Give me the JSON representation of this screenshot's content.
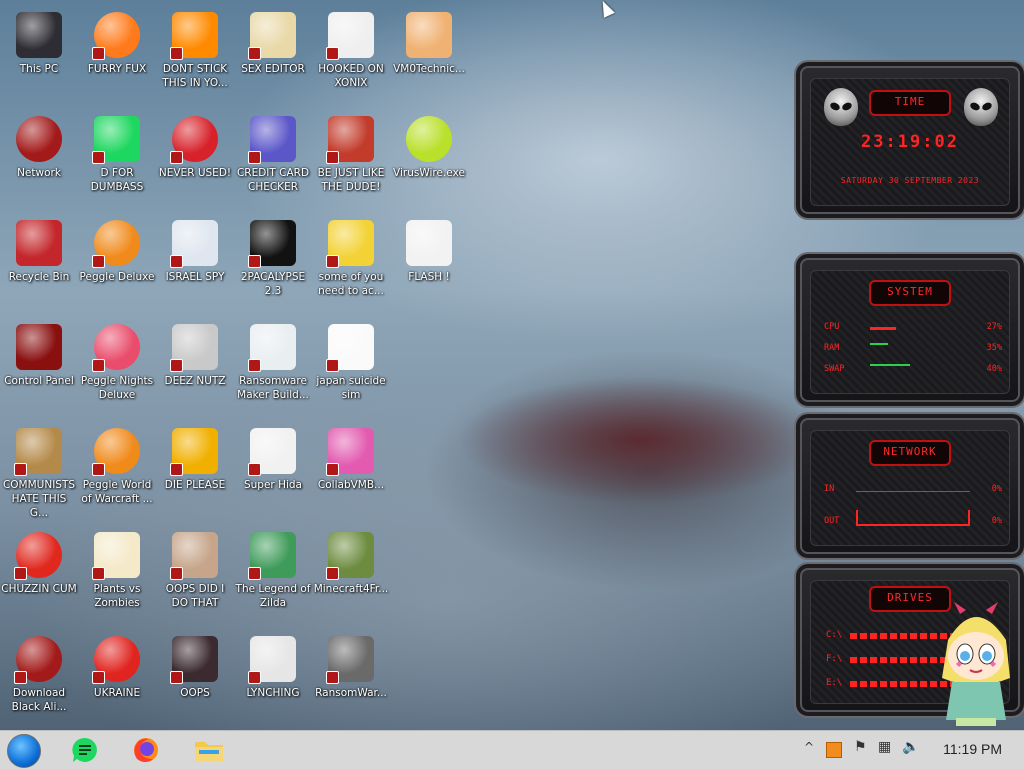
{
  "desktop": {
    "icons": [
      {
        "label": "This PC",
        "kind": "monitor"
      },
      {
        "label": "Network",
        "kind": "alien-red"
      },
      {
        "label": "Recycle Bin",
        "kind": "trash-red"
      },
      {
        "label": "Control Panel",
        "kind": "panel-red"
      },
      {
        "label": "COMMUNISTS HATE THIS G...",
        "kind": "money-bag"
      },
      {
        "label": "CHUZZIN CUM",
        "kind": "red-fuzzy"
      },
      {
        "label": "Download Black Ali...",
        "kind": "alien-red"
      },
      {
        "label": "FURRY FUX",
        "kind": "firefox"
      },
      {
        "label": "D FOR DUMBASS",
        "kind": "green-chat"
      },
      {
        "label": "Peggle Deluxe",
        "kind": "peggle"
      },
      {
        "label": "Peggle Nights Deluxe",
        "kind": "peggle-moon"
      },
      {
        "label": "Peggle World of Warcraft ...",
        "kind": "peggle"
      },
      {
        "label": "Plants vs Zombies",
        "kind": "flower"
      },
      {
        "label": "UKRAINE",
        "kind": "radiation"
      },
      {
        "label": "DONT STICK THIS IN YO...",
        "kind": "cone"
      },
      {
        "label": "NEVER USED!",
        "kind": "devcpp"
      },
      {
        "label": "ISRAEL SPY",
        "kind": "device"
      },
      {
        "label": "DEEZ NUTZ",
        "kind": "windows-stack"
      },
      {
        "label": "DIE PLEASE",
        "kind": "de-logo"
      },
      {
        "label": "OOPS DID I DO THAT",
        "kind": "portrait"
      },
      {
        "label": "OOPS",
        "kind": "dark-case"
      },
      {
        "label": "SEX EDITOR",
        "kind": "hxd"
      },
      {
        "label": "CREDIT CARD CHECKER",
        "kind": "card"
      },
      {
        "label": "2PACALYPSE 2.3",
        "kind": "terminal"
      },
      {
        "label": "Ransomware Maker Build...",
        "kind": "window-app"
      },
      {
        "label": "Super Hida",
        "kind": "pixel-dog"
      },
      {
        "label": "The Legend of Zilda",
        "kind": "pixel-hero"
      },
      {
        "label": "LYNCHING",
        "kind": "noose"
      },
      {
        "label": "HOOKED ON XONIX",
        "kind": "xonix"
      },
      {
        "label": "BE JUST LIKE THE DUDE!",
        "kind": "santa"
      },
      {
        "label": "some of you need to ac...",
        "kind": "dog-cartoon"
      },
      {
        "label": "japan suicide sim",
        "kind": "white-sheet"
      },
      {
        "label": "CollabVMB...",
        "kind": "pink-monitor"
      },
      {
        "label": "Minecraft4Fr...",
        "kind": "grass-block"
      },
      {
        "label": "RansomWar...",
        "kind": "skull"
      },
      {
        "label": "VM0Technic...",
        "kind": "doctor"
      },
      {
        "label": "VirusWire.exe",
        "kind": "lime"
      },
      {
        "label": "FLASH !",
        "kind": "flash-doc"
      }
    ]
  },
  "widgets": {
    "time": {
      "title": "TIME",
      "clock": "23:19:02",
      "date": "SATURDAY 30 SEPTEMBER 2023"
    },
    "system": {
      "title": "SYSTEM",
      "rows": [
        {
          "key": "CPU",
          "value": "27%",
          "level": 0.27
        },
        {
          "key": "RAM",
          "value": "35%",
          "level": 0.35
        },
        {
          "key": "SWAP",
          "value": "40%",
          "level": 0.4
        }
      ]
    },
    "network": {
      "title": "NETWORK",
      "rows": [
        {
          "key": "IN",
          "value": "0%"
        },
        {
          "key": "OUT",
          "value": "0%"
        }
      ]
    },
    "drives": {
      "title": "DRIVES",
      "rows": [
        {
          "key": "C:\\"
        },
        {
          "key": "F:\\"
        },
        {
          "key": "E:\\"
        }
      ]
    }
  },
  "taskbar": {
    "apps": [
      {
        "name": "green-chat-app"
      },
      {
        "name": "firefox"
      },
      {
        "name": "file-explorer"
      }
    ],
    "tray": {
      "chevron": "^",
      "clock": "11:19 PM"
    }
  },
  "colors": {
    "widget_red": "#ff2424",
    "taskbar": "#d8d8d8"
  }
}
